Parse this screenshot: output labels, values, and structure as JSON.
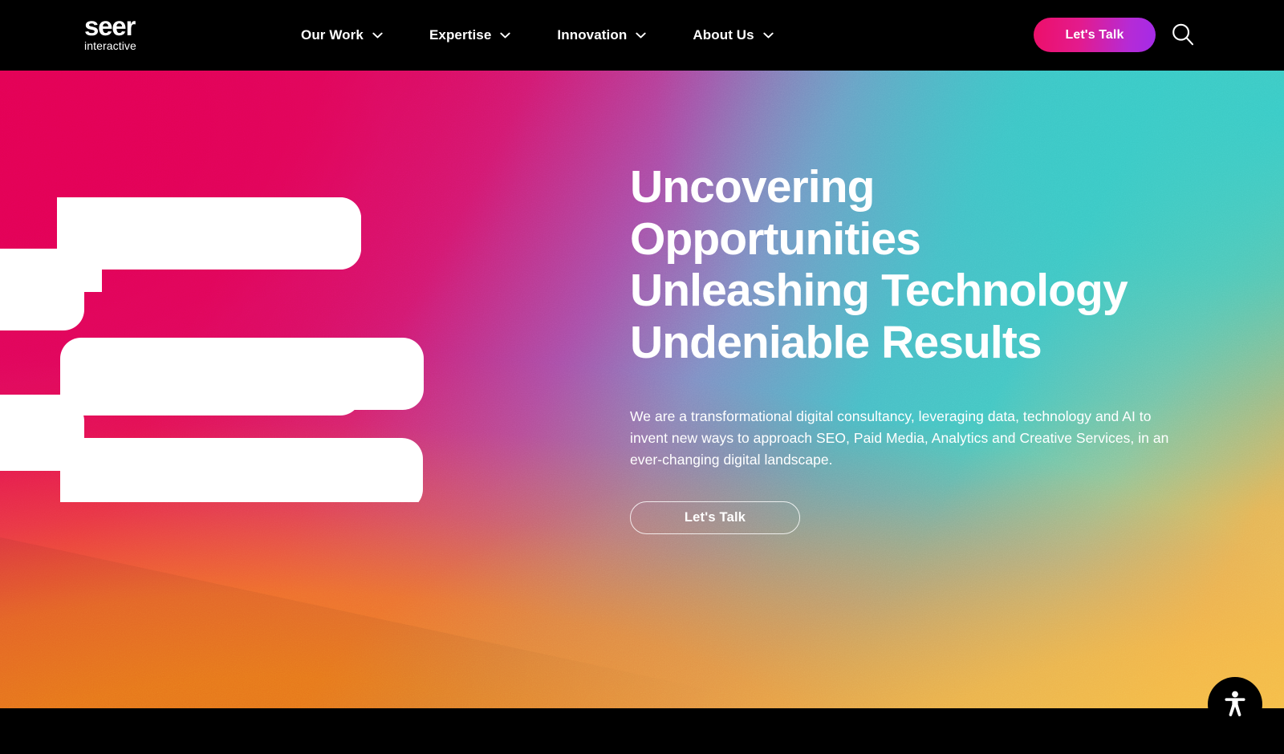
{
  "header": {
    "logo": {
      "name": "seer",
      "tagline": "interactive"
    },
    "nav_items": [
      {
        "label": "Our Work",
        "icon": "chevron-down-icon",
        "has_dropdown": true
      },
      {
        "label": "Expertise",
        "icon": "chevron-down-icon",
        "has_dropdown": true
      },
      {
        "label": "Innovation",
        "icon": "chevron-down-icon",
        "has_dropdown": true
      },
      {
        "label": "About Us",
        "icon": "chevron-down-icon",
        "has_dropdown": true
      }
    ],
    "cta_label": "Let's Talk",
    "search_icon": "search-icon",
    "background_color": "#000000"
  },
  "hero": {
    "headline_lines": [
      "Uncovering",
      "Opportunities",
      "Unleashing Technology",
      "Undeniable Results"
    ],
    "body": "We are a transformational digital consultancy, leveraging data, technology and AI to invent new ways to approach SEO, Paid Media, Analytics and Creative Services, in an ever-changing digital landscape.",
    "cta_label": "Let's Talk",
    "decorative_mark": "seer-e-monogram",
    "gradient_colors": {
      "magenta": "#E3004F",
      "pink": "#D21A72",
      "purple": "#A94FA8",
      "teal": "#3FC9C4",
      "orange": "#F47E1C",
      "gold": "#F5C04A"
    }
  },
  "accessibility_widget": {
    "icon": "accessibility-person-icon",
    "background_color": "#000000"
  }
}
